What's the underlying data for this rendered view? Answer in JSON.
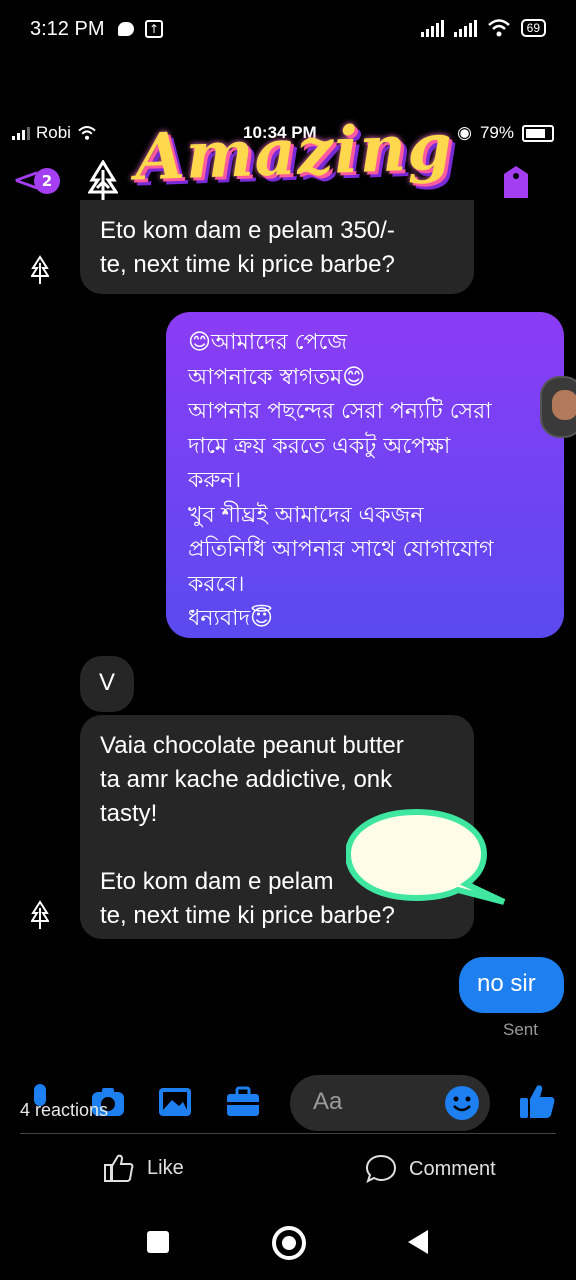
{
  "outer_status": {
    "time": "3:12 PM",
    "battery": "69"
  },
  "inner_status": {
    "carrier": "Robi",
    "time": "10:34 PM",
    "battery": "79%"
  },
  "header": {
    "unread_count": "2",
    "sticker_text": "Amazing"
  },
  "messages": [
    {
      "sender": "them",
      "text": "Eto kom dam e pelam 350/-\nte,  next time ki price barbe?"
    },
    {
      "sender": "me",
      "text": "😊আমাদের পেজে\nআপনাকে স্বাগতম😊\nআপনার পছন্দের সেরা পন্যটি সেরা\nদামে ক্রয় করতে একটু অপেক্ষা\nকরুন।\nখুব শীঘ্রই আমাদের একজন\nপ্রতিনিধি আপনার সাথে যোগাযোগ\nকরবে।\nধন্যবাদ😇"
    },
    {
      "sender": "them",
      "text": "V"
    },
    {
      "sender": "them",
      "text": "Vaia chocolate peanut butter\nta amr kache addictive,  onk\ntasty!\n\nEto kom dam e pelam\nte,  next time ki price barbe?"
    },
    {
      "sender": "me",
      "text": "no sir",
      "status": "Sent"
    }
  ],
  "composer": {
    "placeholder": "Aa"
  },
  "post": {
    "reactions": "4 reactions",
    "like_label": "Like",
    "comment_label": "Comment"
  },
  "colors": {
    "accent": "#a33ef2",
    "bubble_in": "#262626",
    "gradient_top": "#8b3cf5",
    "gradient_bottom": "#5a4af0",
    "send_blue": "#1d7ff0"
  }
}
